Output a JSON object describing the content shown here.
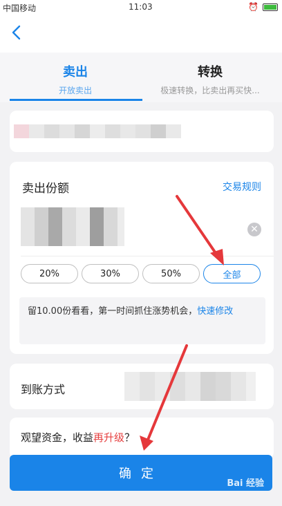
{
  "status_bar": {
    "carrier": "中国移动",
    "time": "11:03"
  },
  "tabs": [
    {
      "label": "卖出",
      "sublabel": "开放卖出",
      "active": true
    },
    {
      "label": "转换",
      "sublabel": "极速转换，比卖出再买快..."
    }
  ],
  "amount_section": {
    "title": "卖出份额",
    "rules_link": "交易规则",
    "percent_options": [
      "20%",
      "30%",
      "50%",
      "全部"
    ],
    "tip_text": "留10.00份看看，第一时间抓住涨势机会，",
    "tip_link": "快速修改"
  },
  "arrival_section": {
    "label": "到账方式"
  },
  "watch_section": {
    "text_prefix": "观望资金，收益",
    "text_highlight": "再升级",
    "text_suffix": "？"
  },
  "confirm_button": "确定",
  "watermark": "Bai 经验",
  "colors": {
    "accent": "#1a84e8",
    "highlight": "#e64040",
    "annotation_arrow": "#e5383b"
  }
}
